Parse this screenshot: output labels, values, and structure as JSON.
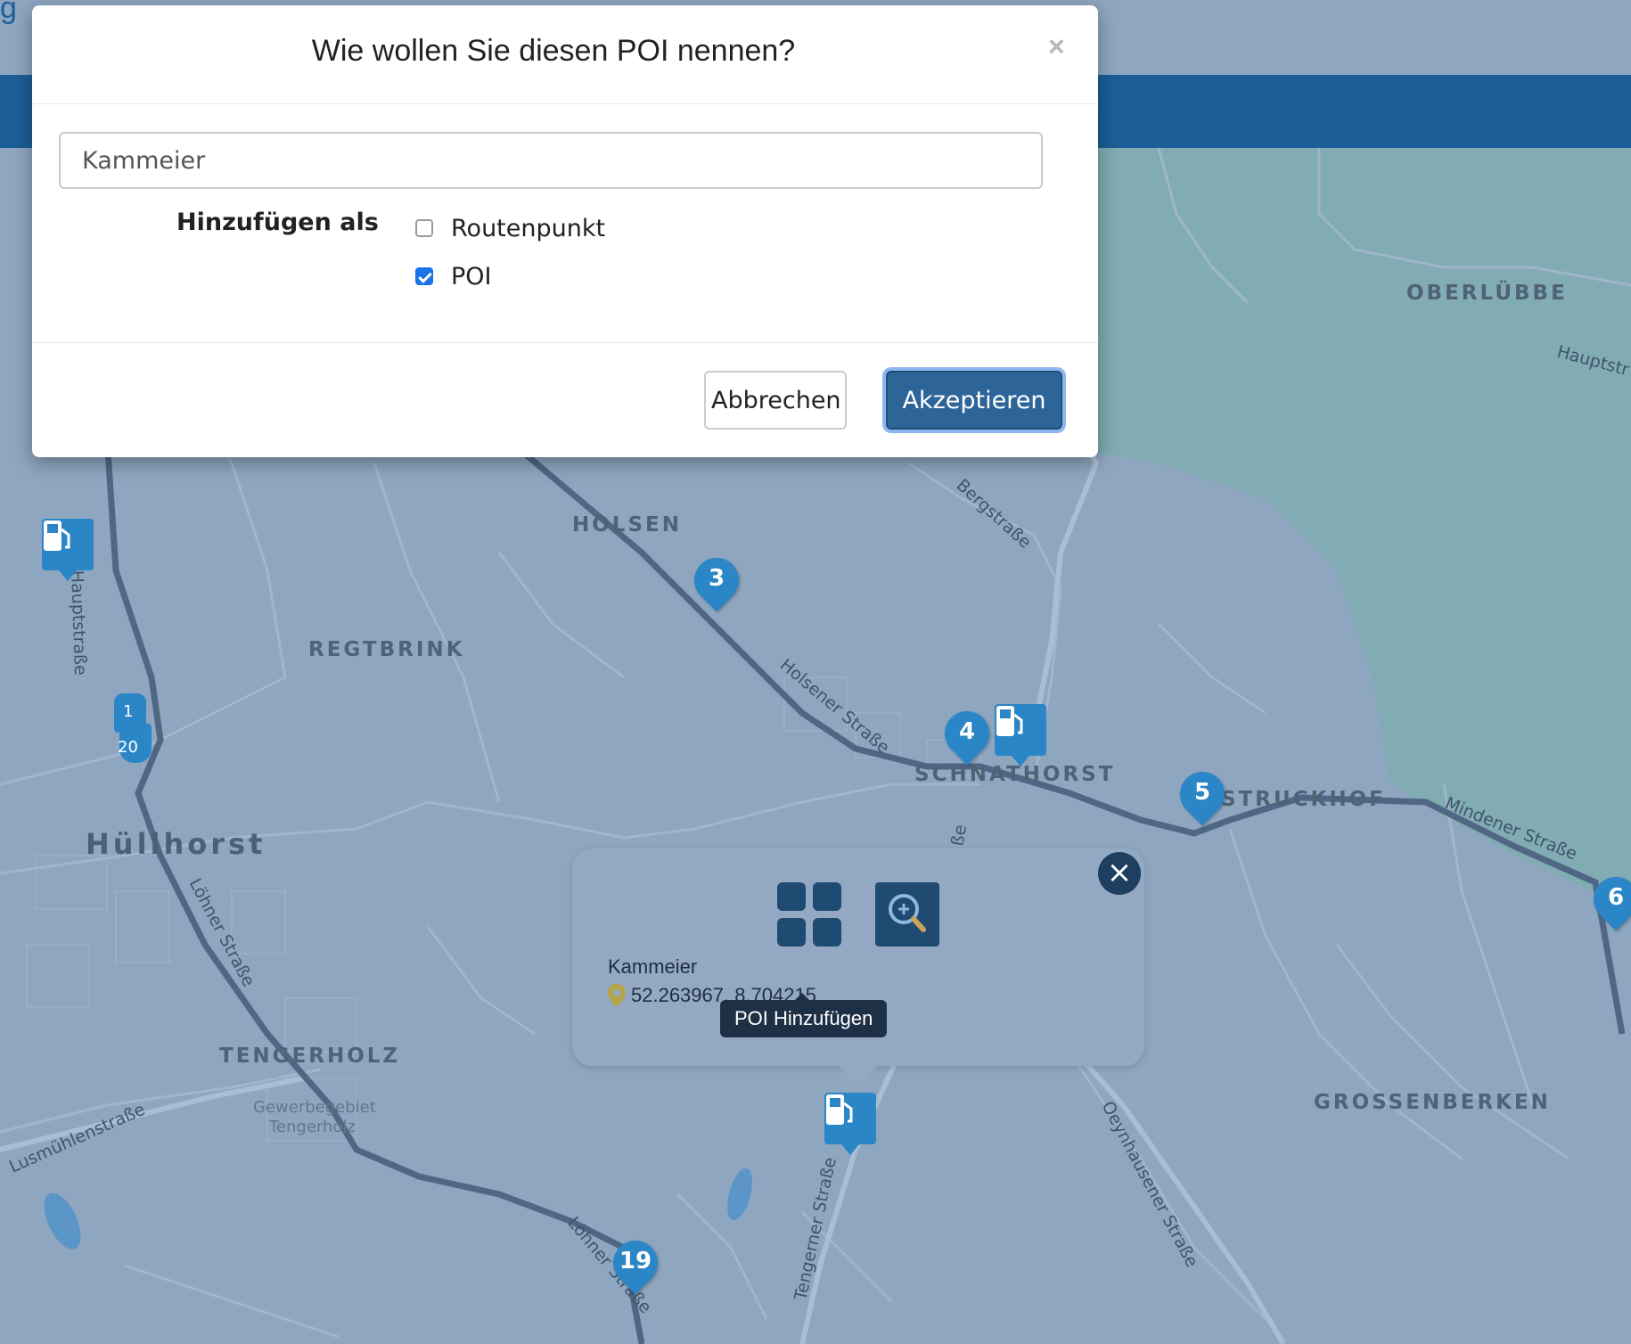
{
  "topbar": {
    "partial_text": "g"
  },
  "modal": {
    "title": "Wie wollen Sie diesen POI nennen?",
    "close_symbol": "×",
    "name_input": {
      "value": "Kammeier",
      "placeholder": ""
    },
    "add_as_label": "Hinzufügen als",
    "options": [
      {
        "label": "Routenpunkt",
        "checked": false
      },
      {
        "label": "POI",
        "checked": true
      }
    ],
    "cancel_label": "Abbrechen",
    "accept_label": "Akzeptieren"
  },
  "map": {
    "places": {
      "oberluebbe": "OBERLÜBBE",
      "holsen": "HOLSEN",
      "regtbrink": "REGTBRINK",
      "schnathorst": "SCHNATHORST",
      "struckhof": "STRUCKHOF",
      "huellhorst": "Hüllhorst",
      "tengerholz": "TENGERHOLZ",
      "grossenberken": "GROSSENBERKEN",
      "gewerbe1": "Gewerbegebiet",
      "gewerbe2": "Tengerholz"
    },
    "streets": {
      "hauptstr_right": "Hauptstr",
      "bergstrasse": "Bergstraße",
      "hauptstrasse_left": "Hauptstraße",
      "holsener": "Holsener Straße",
      "loehner1": "Löhner Straße",
      "lusmuehlen": "Lusmühlenstraße",
      "mindener": "Mindener Straße",
      "oeynhausener": "Oeynhausener Straße",
      "tengerner": "Tengerner Straße",
      "loehner2": "Löhner Straße",
      "strasse_fragment": "ße"
    },
    "route_markers": [
      "3",
      "4",
      "5",
      "6",
      "19"
    ],
    "stacked_markers": [
      "1",
      "20"
    ]
  },
  "popup": {
    "close_symbol": "×",
    "poi_name": "Kammeier",
    "coordinates": "52.263967, 8.704215",
    "tooltip": "POI Hinzufügen"
  },
  "colors": {
    "navbar": "#1c5e98",
    "marker": "#2a86c6",
    "accept_button": "#2e6599",
    "map_overlay": "#8fa6c0"
  },
  "icons": {
    "modal_close": "close-icon",
    "popup_close": "close-icon",
    "add_poi": "add-grid-icon",
    "zoom": "zoom-in-icon",
    "location": "map-pin-icon",
    "fuel": "fuel-station-icon"
  }
}
